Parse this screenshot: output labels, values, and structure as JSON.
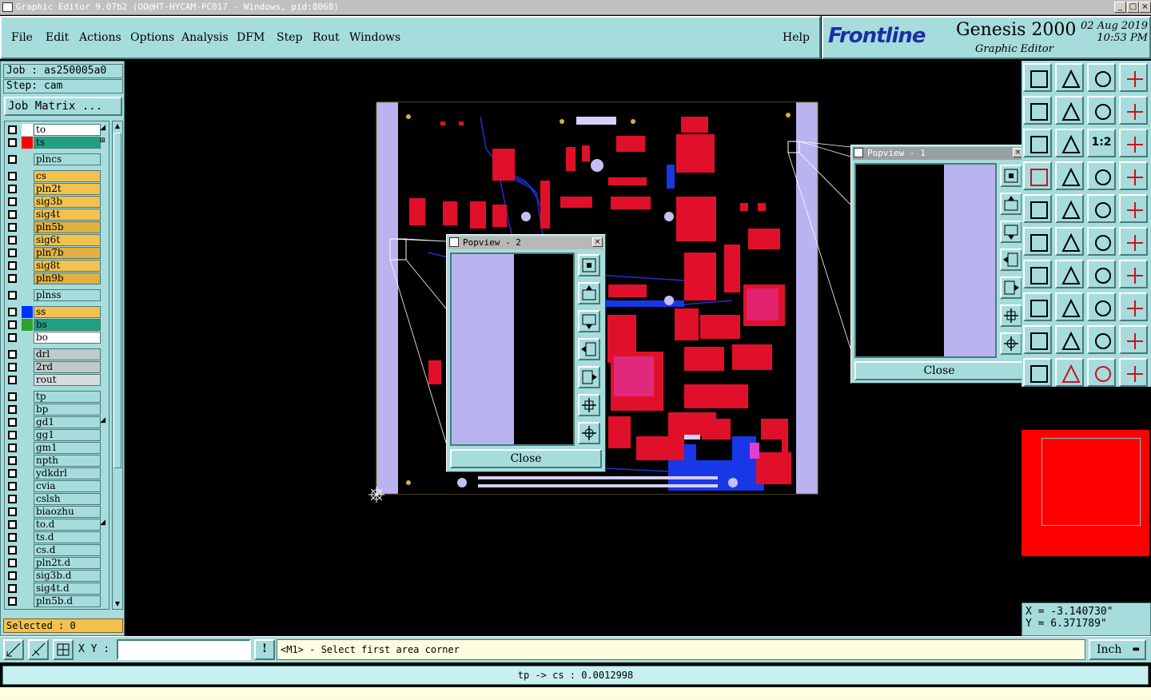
{
  "window": {
    "title": "Graphic Editor 9.07b2 (OO@HT-HYCAM-PC017 - Windows, pid:8068)",
    "btn_min": "_",
    "btn_max": "□",
    "btn_close": "×"
  },
  "menu": {
    "file": "File",
    "edit": "Edit",
    "actions": "Actions",
    "options": "Options",
    "analysis": "Analysis",
    "dfm": "DFM",
    "step": "Step",
    "rout": "Rout",
    "windows": "Windows",
    "help": "Help"
  },
  "header": {
    "brand": "Frontline",
    "product": "Genesis 2000",
    "subtitle": "Graphic Editor",
    "date": "02  Aug  2019",
    "time": "10:53  PM"
  },
  "left": {
    "job": "Job : as250005a0",
    "step": "Step: cam",
    "job_matrix": "Job Matrix ...",
    "selected": "Selected : 0",
    "layers": [
      {
        "name": "to",
        "swatch": "#ffffff",
        "color": "#ffffff",
        "mark": "◢"
      },
      {
        "name": "ts",
        "swatch": "#ff0000",
        "color": "#20a080",
        "mark": "⊞"
      },
      {
        "name": "plncs",
        "swatch": "",
        "color": "#a6dcdc",
        "mark": ""
      },
      {
        "name": "cs",
        "swatch": "",
        "color": "#f2c14e",
        "mark": ""
      },
      {
        "name": "pln2t",
        "swatch": "",
        "color": "#f2c14e",
        "mark": ""
      },
      {
        "name": "sig3b",
        "swatch": "",
        "color": "#f2c14e",
        "mark": ""
      },
      {
        "name": "sig4t",
        "swatch": "",
        "color": "#f2c14e",
        "mark": ""
      },
      {
        "name": "pln5b",
        "swatch": "",
        "color": "#e0b040",
        "mark": ""
      },
      {
        "name": "sig6t",
        "swatch": "",
        "color": "#f2c14e",
        "mark": ""
      },
      {
        "name": "pln7b",
        "swatch": "",
        "color": "#e0b040",
        "mark": ""
      },
      {
        "name": "sig8t",
        "swatch": "",
        "color": "#f2c14e",
        "mark": ""
      },
      {
        "name": "pln9b",
        "swatch": "",
        "color": "#e0b040",
        "mark": ""
      },
      {
        "name": "plnss",
        "swatch": "",
        "color": "#a6dcdc",
        "mark": ""
      },
      {
        "name": "ss",
        "swatch": "#0033ff",
        "color": "#f2c14e",
        "mark": ""
      },
      {
        "name": "bs",
        "swatch": "#30a030",
        "color": "#20a080",
        "mark": ""
      },
      {
        "name": "bo",
        "swatch": "",
        "color": "#ffffff",
        "mark": ""
      },
      {
        "name": "drl",
        "swatch": "",
        "color": "#c0c8c8",
        "mark": ""
      },
      {
        "name": "2rd",
        "swatch": "",
        "color": "#c0c8c8",
        "mark": ""
      },
      {
        "name": "rout",
        "swatch": "",
        "color": "#d8dcdc",
        "mark": ""
      },
      {
        "name": "tp",
        "swatch": "",
        "color": "#a6dcdc",
        "mark": ""
      },
      {
        "name": "bp",
        "swatch": "",
        "color": "#a6dcdc",
        "mark": ""
      },
      {
        "name": "gd1",
        "swatch": "",
        "color": "#a6dcdc",
        "mark": "◢"
      },
      {
        "name": "gg1",
        "swatch": "",
        "color": "#a6dcdc",
        "mark": ""
      },
      {
        "name": "gm1",
        "swatch": "",
        "color": "#a6dcdc",
        "mark": ""
      },
      {
        "name": "npth",
        "swatch": "",
        "color": "#a6dcdc",
        "mark": ""
      },
      {
        "name": "ydkdrl",
        "swatch": "",
        "color": "#a6dcdc",
        "mark": ""
      },
      {
        "name": "cvia",
        "swatch": "",
        "color": "#a6dcdc",
        "mark": ""
      },
      {
        "name": "cslsh",
        "swatch": "",
        "color": "#a6dcdc",
        "mark": ""
      },
      {
        "name": "biaozhu",
        "swatch": "",
        "color": "#a6dcdc",
        "mark": ""
      },
      {
        "name": "to.d",
        "swatch": "",
        "color": "#a6dcdc",
        "mark": "◢"
      },
      {
        "name": "ts.d",
        "swatch": "",
        "color": "#a6dcdc",
        "mark": ""
      },
      {
        "name": "cs.d",
        "swatch": "",
        "color": "#a6dcdc",
        "mark": ""
      },
      {
        "name": "pln2t.d",
        "swatch": "",
        "color": "#a6dcdc",
        "mark": ""
      },
      {
        "name": "sig3b.d",
        "swatch": "",
        "color": "#a6dcdc",
        "mark": ""
      },
      {
        "name": "sig4t.d",
        "swatch": "",
        "color": "#a6dcdc",
        "mark": ""
      },
      {
        "name": "pln5b.d",
        "swatch": "",
        "color": "#a6dcdc",
        "mark": ""
      }
    ]
  },
  "popview1": {
    "title": "Popview - 1",
    "close": "Close"
  },
  "popview2": {
    "title": "Popview - 2",
    "close": "Close"
  },
  "tools": {
    "one_to_two": "1:2"
  },
  "coords": {
    "x": "X = -3.140730\"",
    "y": "Y = 6.371789\""
  },
  "bottom": {
    "xy_label": "X Y :",
    "xy_value": "",
    "info_btn": "!",
    "prompt": "<M1> - Select first area corner",
    "units": "Inch",
    "status": "tp -> cs : 0.0012998"
  }
}
